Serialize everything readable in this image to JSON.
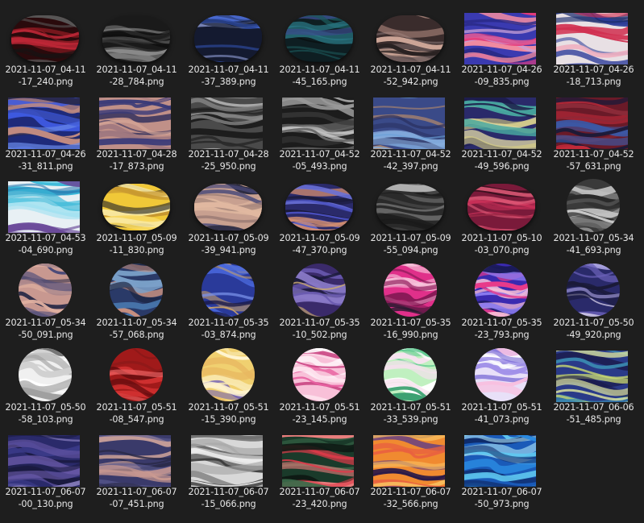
{
  "files": [
    {
      "name_line1": "2021-11-07_04-11",
      "name_line2": "-17_240.png",
      "thumb": {
        "shape": "blob",
        "colors": [
          "#2a0a0c",
          "#8c1a22",
          "#c02838",
          "#5a5a5a",
          "#141414"
        ]
      }
    },
    {
      "name_line1": "2021-11-07_04-11",
      "name_line2": "-28_784.png",
      "thumb": {
        "shape": "blob",
        "colors": [
          "#1a1a1a",
          "#5c5c5c",
          "#8a8a8a",
          "#333333",
          "#0f0f0f"
        ]
      }
    },
    {
      "name_line1": "2021-11-07_04-11",
      "name_line2": "-37_389.png",
      "thumb": {
        "shape": "blob",
        "colors": [
          "#141a30",
          "#2e4aa0",
          "#4a6ad0",
          "#7a86b8",
          "#0e1220"
        ]
      }
    },
    {
      "name_line1": "2021-11-07_04-11",
      "name_line2": "-45_165.png",
      "thumb": {
        "shape": "blob",
        "colors": [
          "#0e1e22",
          "#1c5a5c",
          "#2a7a88",
          "#3a4a8a",
          "#0a1214"
        ]
      }
    },
    {
      "name_line1": "2021-11-07_04-11",
      "name_line2": "-52_942.png",
      "thumb": {
        "shape": "blob",
        "colors": [
          "#3a2c2c",
          "#b08a80",
          "#d0a89a",
          "#6a5a5a",
          "#2a2222"
        ]
      }
    },
    {
      "name_line1": "2021-11-07_04-26",
      "name_line2": "-09_835.png",
      "thumb": {
        "shape": "rect",
        "colors": [
          "#3a3ab0",
          "#e83a78",
          "#f08aa0",
          "#2a2a88",
          "#c8a0d8"
        ]
      }
    },
    {
      "name_line1": "2021-11-07_04-26",
      "name_line2": "-18_713.png",
      "thumb": {
        "shape": "rect",
        "colors": [
          "#e8e0e4",
          "#2a3a98",
          "#d03050",
          "#f0b0c0",
          "#203070"
        ]
      }
    },
    {
      "name_line1": "2021-11-07_04-26",
      "name_line2": "-31_811.png",
      "thumb": {
        "shape": "rect",
        "colors": [
          "#1e2a7a",
          "#3e5ae0",
          "#c08a80",
          "#2a2a50",
          "#6a8ae8"
        ]
      }
    },
    {
      "name_line1": "2021-11-07_04-28",
      "name_line2": "-17_873.png",
      "thumb": {
        "shape": "rect",
        "colors": [
          "#c09088",
          "#3a3a78",
          "#d8a898",
          "#2a2a5a",
          "#a07880"
        ]
      }
    },
    {
      "name_line1": "2021-11-07_04-28",
      "name_line2": "-25_950.png",
      "thumb": {
        "shape": "rect",
        "colors": [
          "#4a4a4a",
          "#8a8a8a",
          "#2a2a2a",
          "#b0b0b0",
          "#1a1a1a"
        ]
      }
    },
    {
      "name_line1": "2021-11-07_04-52",
      "name_line2": "-05_493.png",
      "thumb": {
        "shape": "rect",
        "colors": [
          "#1c1c1c",
          "#6a6a6a",
          "#c8c8c8",
          "#3a3a3a",
          "#9a9a9a"
        ]
      }
    },
    {
      "name_line1": "2021-11-07_04-52",
      "name_line2": "-42_397.png",
      "thumb": {
        "shape": "rect",
        "colors": [
          "#3a4a88",
          "#6aa0d8",
          "#c09068",
          "#2a3060",
          "#8ab0e0"
        ]
      }
    },
    {
      "name_line1": "2021-11-07_04-52",
      "name_line2": "-49_596.png",
      "thumb": {
        "shape": "rect",
        "colors": [
          "#2a2a6a",
          "#d8d080",
          "#48a8a0",
          "#1a1a48",
          "#e8e0a8"
        ]
      }
    },
    {
      "name_line1": "2021-11-07_04-52",
      "name_line2": "-57_631.png",
      "thumb": {
        "shape": "rect",
        "colors": [
          "#6a1a28",
          "#c02a3a",
          "#3a5aa8",
          "#1a1a38",
          "#8a2a38"
        ]
      }
    },
    {
      "name_line1": "2021-11-07_04-53",
      "name_line2": "-04_690.png",
      "thumb": {
        "shape": "rect",
        "colors": [
          "#e8f0f4",
          "#38b8d8",
          "#6a4a9a",
          "#a0e0f0",
          "#2a7ab0"
        ]
      }
    },
    {
      "name_line1": "2021-11-07_05-09",
      "name_line2": "-11_830.png",
      "thumb": {
        "shape": "blob",
        "colors": [
          "#f0c838",
          "#f8e8a0",
          "#c89830",
          "#2a2a2a",
          "#f8d860"
        ]
      }
    },
    {
      "name_line1": "2021-11-07_05-09",
      "name_line2": "-39_941.png",
      "thumb": {
        "shape": "blob",
        "colors": [
          "#c8a090",
          "#4a4a7a",
          "#e0b8a0",
          "#2a2a40",
          "#a08078"
        ]
      }
    },
    {
      "name_line1": "2021-11-07_05-09",
      "name_line2": "-47_370.png",
      "thumb": {
        "shape": "blob",
        "colors": [
          "#2a2a6a",
          "#4a50c0",
          "#d89070",
          "#1a1a38",
          "#6a70d8"
        ]
      }
    },
    {
      "name_line1": "2021-11-07_05-09",
      "name_line2": "-55_094.png",
      "thumb": {
        "shape": "blob",
        "colors": [
          "#2a2a2a",
          "#7a7a7a",
          "#b0b0b0",
          "#1a1a1a",
          "#4a4a4a"
        ]
      }
    },
    {
      "name_line1": "2021-11-07_05-10",
      "name_line2": "-03_070.png",
      "thumb": {
        "shape": "blob",
        "colors": [
          "#7a1a3a",
          "#c83058",
          "#e05a78",
          "#3a1020",
          "#a02848"
        ]
      }
    },
    {
      "name_line1": "2021-11-07_05-34",
      "name_line2": "-41_693.png",
      "thumb": {
        "shape": "circle",
        "colors": [
          "#3a3a3a",
          "#9a9a9a",
          "#5a5a5a",
          "#c8c8c8",
          "#2a2a2a"
        ]
      }
    },
    {
      "name_line1": "2021-11-07_05-34",
      "name_line2": "-50_091.png",
      "thumb": {
        "shape": "circle",
        "colors": [
          "#c89890",
          "#4a4a78",
          "#e0b0a0",
          "#2a2a48",
          "#a08088"
        ]
      }
    },
    {
      "name_line1": "2021-11-07_05-34",
      "name_line2": "-57_068.png",
      "thumb": {
        "shape": "circle",
        "colors": [
          "#2a3a68",
          "#4a7ab0",
          "#7aa0c8",
          "#1a2440",
          "#c89080"
        ]
      }
    },
    {
      "name_line1": "2021-11-07_05-35",
      "name_line2": "-03_874.png",
      "thumb": {
        "shape": "circle",
        "colors": [
          "#2a3a9a",
          "#4a6ae0",
          "#c8a068",
          "#1a1a48",
          "#7a90e8"
        ]
      }
    },
    {
      "name_line1": "2021-11-07_05-35",
      "name_line2": "-10_502.png",
      "thumb": {
        "shape": "circle",
        "colors": [
          "#3a2a6a",
          "#6a5ab0",
          "#c8a870",
          "#1a1a38",
          "#8a7ac8"
        ]
      }
    },
    {
      "name_line1": "2021-11-07_05-35",
      "name_line2": "-16_990.png",
      "thumb": {
        "shape": "circle",
        "colors": [
          "#e0308a",
          "#f0a0c8",
          "#8a1a58",
          "#2a1a30",
          "#f8d0e0"
        ]
      }
    },
    {
      "name_line1": "2021-11-07_05-35",
      "name_line2": "-23_793.png",
      "thumb": {
        "shape": "circle",
        "colors": [
          "#3a2ab0",
          "#e83a8a",
          "#f8c0d8",
          "#1a1a58",
          "#8a7af0"
        ]
      }
    },
    {
      "name_line1": "2021-11-07_05-50",
      "name_line2": "-49_920.png",
      "thumb": {
        "shape": "circle",
        "colors": [
          "#2a2a6a",
          "#e0d8f0",
          "#6a60b8",
          "#1a1a38",
          "#a8a0e0"
        ]
      }
    },
    {
      "name_line1": "2021-11-07_05-50",
      "name_line2": "-58_103.png",
      "thumb": {
        "shape": "circle",
        "colors": [
          "#f0f0f0",
          "#a0a0a0",
          "#d0d0d0",
          "#707070",
          "#ffffff"
        ]
      }
    },
    {
      "name_line1": "2021-11-07_05-51",
      "name_line2": "-08_547.png",
      "thumb": {
        "shape": "circle",
        "colors": [
          "#a01a1a",
          "#d03030",
          "#6a0e10",
          "#e86060",
          "#881818"
        ]
      }
    },
    {
      "name_line1": "2021-11-07_05-51",
      "name_line2": "-15_390.png",
      "thumb": {
        "shape": "circle",
        "colors": [
          "#f0d070",
          "#f8e8b0",
          "#6a5ab8",
          "#e8b860",
          "#fff4d0"
        ]
      }
    },
    {
      "name_line1": "2021-11-07_05-51",
      "name_line2": "-23_145.png",
      "thumb": {
        "shape": "circle",
        "colors": [
          "#f8c0d8",
          "#e860a0",
          "#ffffff",
          "#c84080",
          "#fde0ec"
        ]
      }
    },
    {
      "name_line1": "2021-11-07_05-51",
      "name_line2": "-33_539.png",
      "thumb": {
        "shape": "circle",
        "colors": [
          "#c0f0c0",
          "#60c890",
          "#f8e0f0",
          "#3aa070",
          "#ffffff"
        ]
      }
    },
    {
      "name_line1": "2021-11-07_05-51",
      "name_line2": "-41_073.png",
      "thumb": {
        "shape": "circle",
        "colors": [
          "#e8e0f8",
          "#a090e8",
          "#f8c0e0",
          "#6a5ad0",
          "#ffffff"
        ]
      }
    },
    {
      "name_line1": "2021-11-07_06-06",
      "name_line2": "-51_485.png",
      "thumb": {
        "shape": "rect",
        "colors": [
          "#2a3a88",
          "#c8d870",
          "#3a8ab0",
          "#1a1a48",
          "#e0e8a0"
        ]
      }
    },
    {
      "name_line1": "2021-11-07_06-07",
      "name_line2": "-00_130.png",
      "thumb": {
        "shape": "rect",
        "colors": [
          "#2a2a6a",
          "#6a5aa8",
          "#1a1a40",
          "#8a80c0",
          "#3a3a88"
        ]
      }
    },
    {
      "name_line1": "2021-11-07_06-07",
      "name_line2": "-07_451.png",
      "thumb": {
        "shape": "rect",
        "colors": [
          "#3a3a6a",
          "#c89890",
          "#2a2a48",
          "#e0b0a0",
          "#5a5a90"
        ]
      }
    },
    {
      "name_line1": "2021-11-07_06-07",
      "name_line2": "-15_066.png",
      "thumb": {
        "shape": "rect",
        "colors": [
          "#d8d8d8",
          "#6a6a6a",
          "#a8a8a8",
          "#3a3a3a",
          "#f0f0f0"
        ]
      }
    },
    {
      "name_line1": "2021-11-07_06-07",
      "name_line2": "-23_420.png",
      "thumb": {
        "shape": "rect",
        "colors": [
          "#1a3a2a",
          "#e03a4a",
          "#3a6a4a",
          "#0e1a14",
          "#f08080"
        ]
      }
    },
    {
      "name_line1": "2021-11-07_06-07",
      "name_line2": "-32_566.png",
      "thumb": {
        "shape": "rect",
        "colors": [
          "#f08a30",
          "#5a3a8a",
          "#f8c060",
          "#2a1a48",
          "#e86040"
        ]
      }
    },
    {
      "name_line1": "2021-11-07_06-07",
      "name_line2": "-50_973.png",
      "thumb": {
        "shape": "rect",
        "colors": [
          "#1a5ab8",
          "#60c8f0",
          "#0e2a68",
          "#b0e8f8",
          "#2a8ae0"
        ]
      }
    }
  ]
}
